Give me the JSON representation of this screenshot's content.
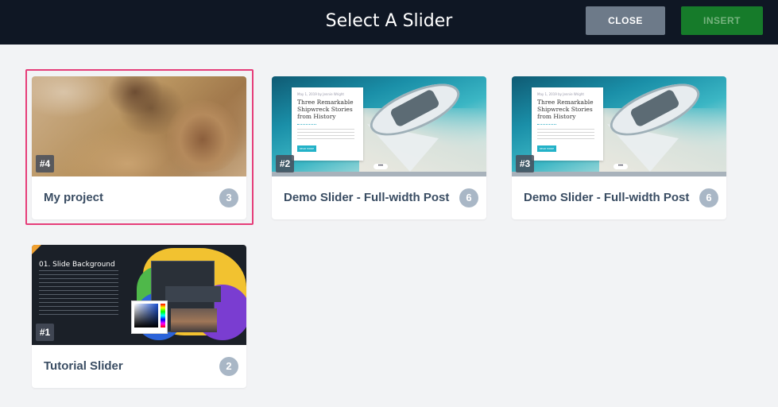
{
  "header": {
    "title": "Select A Slider",
    "close_label": "CLOSE",
    "insert_label": "INSERT"
  },
  "sliders": [
    {
      "id": "#4",
      "name": "My project",
      "slide_count": "3",
      "selected": true,
      "thumbnail": "cat-fur-photo"
    },
    {
      "id": "#2",
      "name": "Demo Slider - Full-width Post",
      "slide_count": "6",
      "selected": false,
      "thumbnail": "shipwreck-beach",
      "post": {
        "meta": "May 1, 2019 by Jennie Wright",
        "title": "Three Remarkable Shipwreck Stories from History",
        "button": "READ MORE"
      }
    },
    {
      "id": "#3",
      "name": "Demo Slider - Full-width Post",
      "slide_count": "6",
      "selected": false,
      "thumbnail": "shipwreck-beach",
      "post": {
        "meta": "May 1, 2019 by Jennie Wright",
        "title": "Three Remarkable Shipwreck Stories from History",
        "button": "READ MORE"
      }
    },
    {
      "id": "#1",
      "name": "Tutorial Slider",
      "slide_count": "2",
      "selected": false,
      "thumbnail": "tutorial-slide-background",
      "tutorial": {
        "heading": "01. Slide Background"
      }
    }
  ],
  "colors": {
    "header_bg": "#0f1724",
    "close_button": "#6d7a89",
    "insert_button": "#167b2a",
    "selection_border": "#e63d79",
    "count_badge": "#a9b7c6"
  }
}
